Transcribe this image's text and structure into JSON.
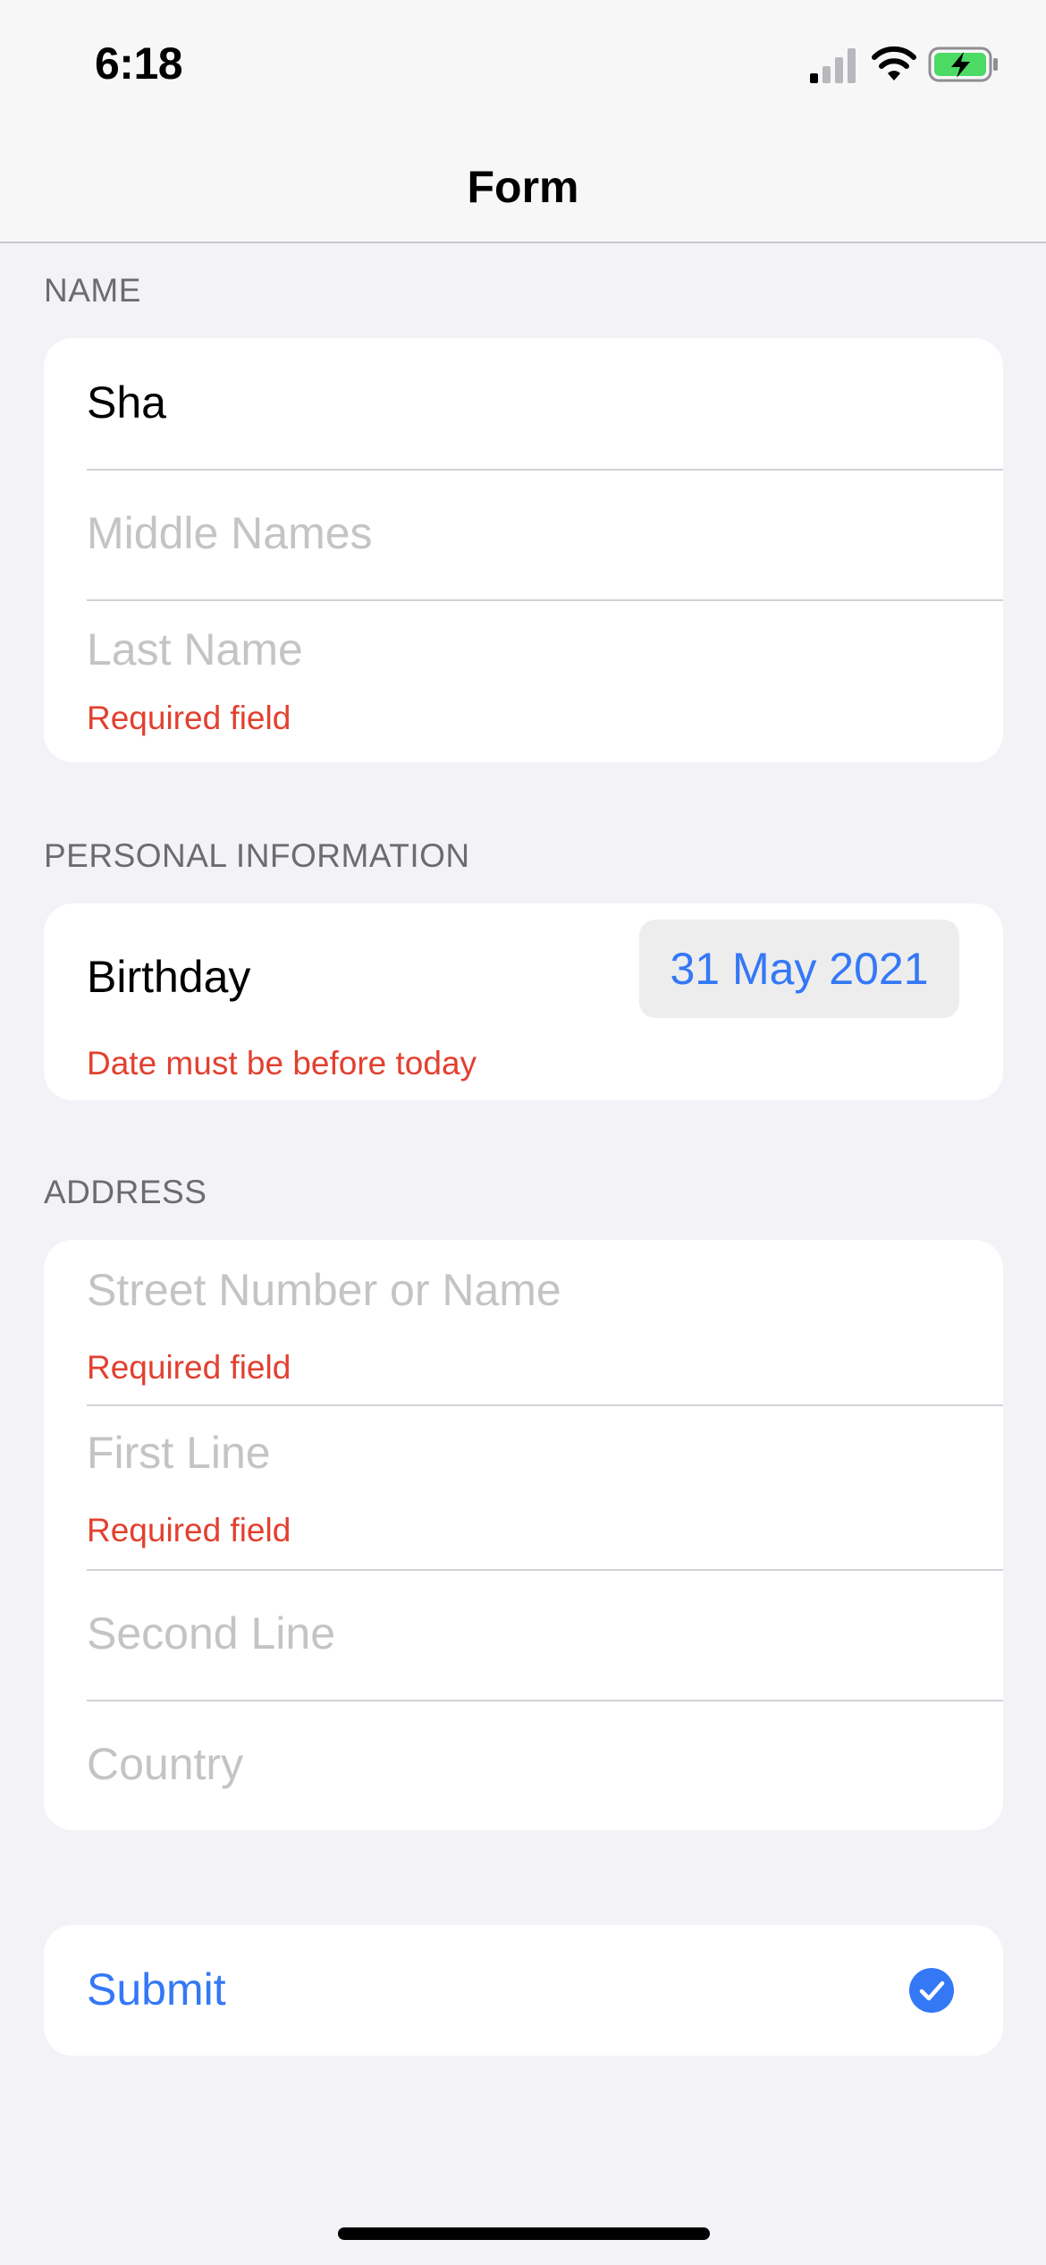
{
  "status_bar": {
    "time": "6:18"
  },
  "nav": {
    "title": "Form"
  },
  "name_section": {
    "header": "NAME",
    "first_name": "Sha",
    "middle_placeholder": "Middle Names",
    "last_placeholder": "Last Name",
    "last_error": "Required field"
  },
  "personal_section": {
    "header": "PERSONAL INFORMATION",
    "birthday_label": "Birthday",
    "birthday_value": "31 May 2021",
    "birthday_error": "Date must be before today"
  },
  "address_section": {
    "header": "ADDRESS",
    "street_placeholder": "Street Number or Name",
    "street_error": "Required field",
    "first_line_placeholder": "First Line",
    "first_line_error": "Required field",
    "second_line_placeholder": "Second Line",
    "country_placeholder": "Country"
  },
  "submit": {
    "label": "Submit",
    "icon": "checkmark-circle-icon"
  },
  "colors": {
    "accent": "#3478F6",
    "error": "#E2402F",
    "battery": "#4CD964",
    "background": "#F2F2F7"
  }
}
